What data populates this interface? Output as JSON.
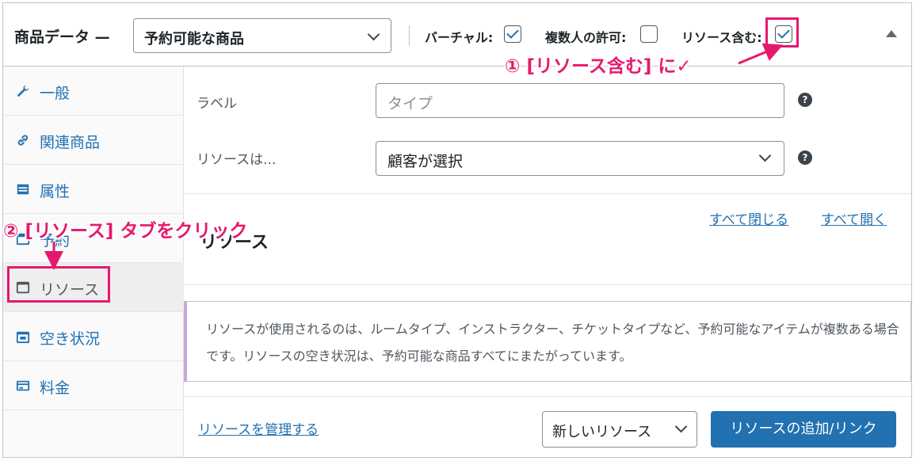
{
  "header": {
    "title": "商品データ —",
    "product_type": "予約可能な商品",
    "virtual_label": "バーチャル:",
    "virtual_checked": true,
    "multi_label": "複数人の許可:",
    "multi_checked": false,
    "resources_label": "リソース含む:",
    "resources_checked": true
  },
  "sidebar": {
    "items": [
      {
        "label": "一般",
        "icon": "wrench-icon"
      },
      {
        "label": "関連商品",
        "icon": "link-icon"
      },
      {
        "label": "属性",
        "icon": "table-icon"
      },
      {
        "label": "予約",
        "icon": "calendar-icon"
      },
      {
        "label": "リソース",
        "icon": "window-icon"
      },
      {
        "label": "空き状況",
        "icon": "calendar-icon"
      },
      {
        "label": "料金",
        "icon": "card-icon"
      }
    ],
    "active_index": 4
  },
  "fields": {
    "label_label": "ラベル",
    "label_placeholder": "タイプ",
    "resources_are_label": "リソースは...",
    "resources_are_value": "顧客が選択",
    "help_glyph": "?"
  },
  "section": {
    "close_all": "すべて閉じる",
    "open_all": "すべて開く",
    "title": "リソース"
  },
  "notice": {
    "text": "リソースが使用されるのは、ルームタイプ、インストラクター、チケットタイプなど、予約可能なアイテムが複数ある場合です。リソースの空き状況は、予約可能な商品すべてにまたがっています。"
  },
  "footer": {
    "manage_link": "リソースを管理する",
    "new_resource": "新しいリソース",
    "add_button": "リソースの追加/リンク"
  },
  "annotations": {
    "step1": "① [リソース含む] に✓",
    "step2": "② [リソース] タブをクリック",
    "color": "#e6186d"
  }
}
